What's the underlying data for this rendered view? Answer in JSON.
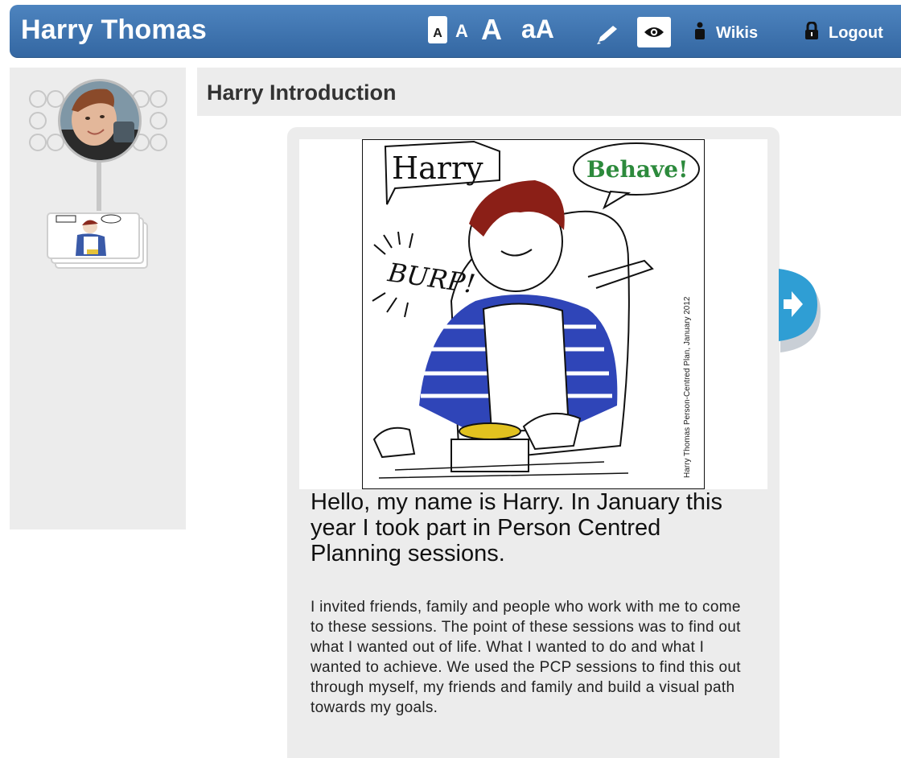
{
  "header": {
    "title": "Harry Thomas",
    "font_controls": {
      "small": "A",
      "medium": "A",
      "large": "A",
      "case_toggle": "aA"
    },
    "edit_icon": "pencil-icon",
    "view_icon": "eye-icon",
    "wikis_label": "Wikis",
    "wikis_icon": "person-icon",
    "logout_label": "Logout",
    "logout_icon": "padlock-icon",
    "colors": {
      "bar": "#3f76b2",
      "text": "#ffffff"
    }
  },
  "sidebar": {
    "avatar_icon": "profile-photo",
    "page_thumbnail": "page-stack-thumbnail"
  },
  "page": {
    "title": "Harry Introduction",
    "image": {
      "label_harry": "Harry",
      "label_behave": "Behave!",
      "label_burp": "BURP!",
      "caption": "Harry Thomas Person-Centred Plan, January 2012"
    },
    "heading": "Hello, my name is Harry. In January this year I took part in Person Centred Planning sessions.",
    "body": "I invited friends, family and people who work with me to come to these sessions. The point of these sessions was to find out what I wanted out of life. What I wanted to do and what I wanted to achieve. We used the PCP sessions to find this out through myself, my friends and family and build a visual path towards my goals.",
    "next_icon": "arrow-right-icon"
  }
}
